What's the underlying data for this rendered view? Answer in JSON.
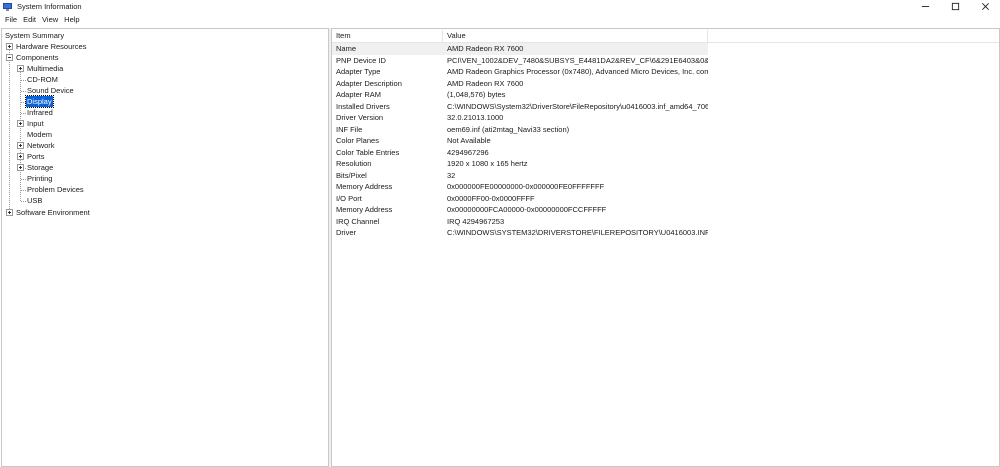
{
  "window": {
    "title": "System Information",
    "controls": [
      "minimize-icon",
      "maximize-icon",
      "close-icon"
    ]
  },
  "menu": [
    "File",
    "Edit",
    "View",
    "Help"
  ],
  "tree": {
    "root": "System Summary",
    "hardware": "Hardware Resources",
    "components": "Components",
    "children": [
      "Multimedia",
      "CD-ROM",
      "Sound Device",
      "Display",
      "Infrared",
      "Input",
      "Modem",
      "Network",
      "Ports",
      "Storage",
      "Printing",
      "Problem Devices",
      "USB"
    ],
    "software": "Software Environment",
    "selected": "Display"
  },
  "table": {
    "headers": {
      "item": "Item",
      "value": "Value"
    },
    "rows": [
      {
        "item": "Name",
        "value": "AMD Radeon RX 7600"
      },
      {
        "item": "PNP Device ID",
        "value": "PCI\\VEN_1002&DEV_7480&SUBSYS_E4481DA2&REV_CF\\6&291E6403&0&0000..."
      },
      {
        "item": "Adapter Type",
        "value": "AMD Radeon Graphics Processor (0x7480), Advanced Micro Devices, Inc. com..."
      },
      {
        "item": "Adapter Description",
        "value": "AMD Radeon RX 7600"
      },
      {
        "item": "Adapter RAM",
        "value": "(1,048,576) bytes"
      },
      {
        "item": "Installed Drivers",
        "value": "C:\\WINDOWS\\System32\\DriverStore\\FileRepository\\u0416003.inf_amd64_706c..."
      },
      {
        "item": "Driver Version",
        "value": "32.0.21013.1000"
      },
      {
        "item": "INF File",
        "value": "oem69.inf (ati2mtag_Navi33 section)"
      },
      {
        "item": "Color Planes",
        "value": "Not Available"
      },
      {
        "item": "Color Table Entries",
        "value": "4294967296"
      },
      {
        "item": "Resolution",
        "value": "1920 x 1080 x 165 hertz"
      },
      {
        "item": "Bits/Pixel",
        "value": "32"
      },
      {
        "item": "Memory Address",
        "value": "0x000000FE00000000-0x000000FE0FFFFFFF"
      },
      {
        "item": "I/O Port",
        "value": "0x0000FF00-0x0000FFFF"
      },
      {
        "item": "Memory Address",
        "value": "0x00000000FCA00000-0x00000000FCCFFFFF"
      },
      {
        "item": "IRQ Channel",
        "value": "IRQ 4294967253"
      },
      {
        "item": "Driver",
        "value": "C:\\WINDOWS\\SYSTEM32\\DRIVERSTORE\\FILEREPOSITORY\\U0416003.INF_AMD..."
      }
    ]
  },
  "colors": {
    "selection": "#0a64d8",
    "rowHighlight": "#f0f0f0",
    "border": "#c8c8c8"
  }
}
